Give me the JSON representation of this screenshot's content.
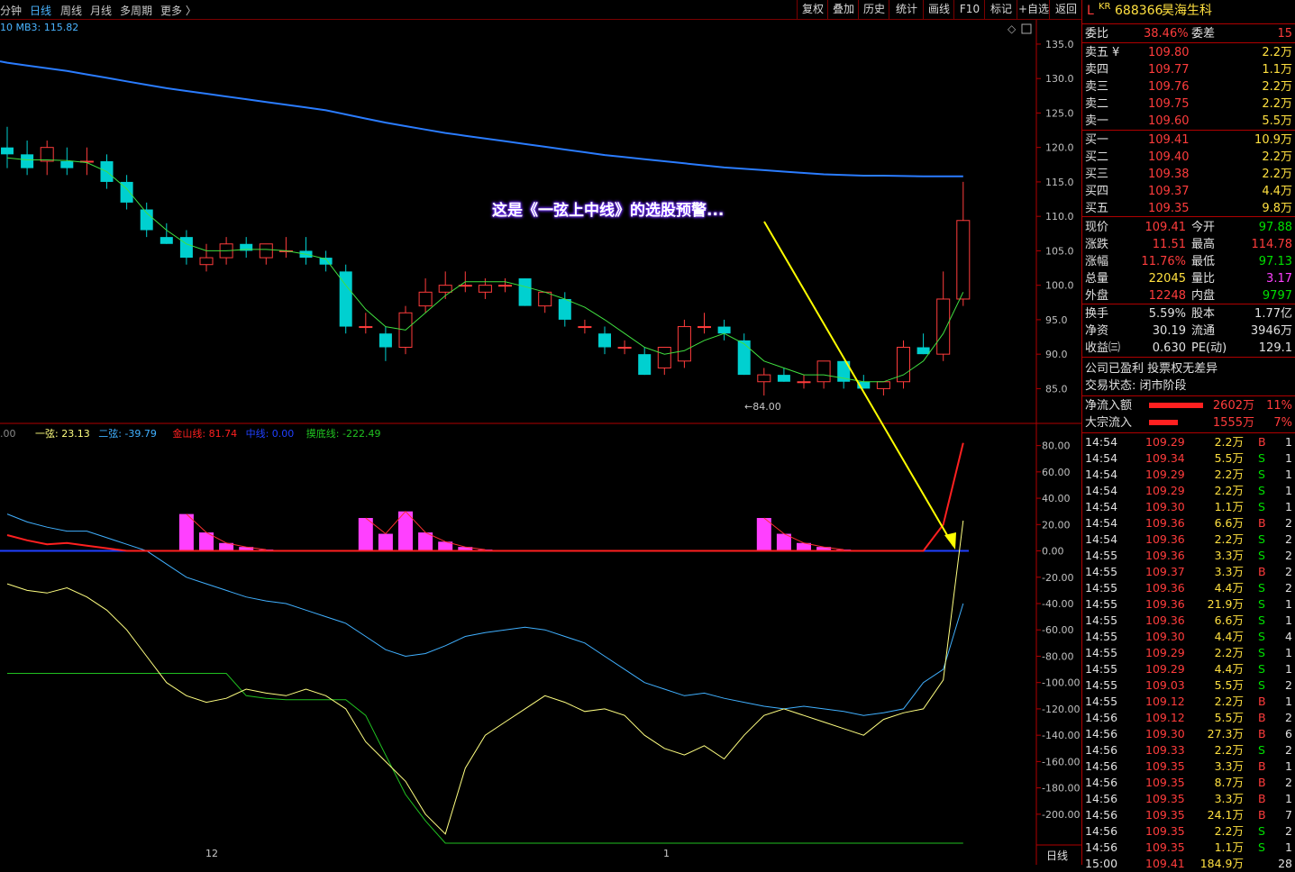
{
  "toolbar": {
    "periods": [
      "分钟",
      "日线",
      "周线",
      "月线",
      "多周期",
      "更多 〉"
    ],
    "active_period": "日线",
    "buttons": [
      "复权",
      "叠加",
      "历史",
      "统计",
      "画线",
      "F10",
      "标记",
      "+自选",
      "返回"
    ]
  },
  "main_chart": {
    "ma_label": "10  MB3: 115.82",
    "low_marker": "←84.00",
    "y_ticks": [
      "135.0",
      "130.0",
      "125.0",
      "120.0",
      "115.0",
      "110.0",
      "105.0",
      "100.0",
      "95.0",
      "90.0",
      "85.0"
    ],
    "annotation": "这是《一弦上中线》的选股预警..."
  },
  "indicator": {
    "prefix": ".00",
    "legend": [
      {
        "label": "一弦: 23.13",
        "color": "#ffff80"
      },
      {
        "label": "二弦: -39.79",
        "color": "#40b0ff"
      },
      {
        "label": "金山线: 81.74",
        "color": "#ff2020"
      },
      {
        "label": "中线: 0.00",
        "color": "#2040ff"
      },
      {
        "label": "摸底线: -222.49",
        "color": "#20c020"
      }
    ],
    "y_ticks": [
      "80.00",
      "60.00",
      "40.00",
      "20.00",
      "0.00",
      "-20.00",
      "-40.00",
      "-60.00",
      "-80.00",
      "-100.00",
      "-120.00",
      "-140.00",
      "-160.00",
      "-180.00",
      "-200.00"
    ],
    "x_labels": [
      "12",
      "1"
    ],
    "period_tab": "日线"
  },
  "stock": {
    "flag": "L",
    "market": "KR",
    "code": "688366",
    "name": "昊海生科"
  },
  "order_ratio": {
    "label": "委比",
    "value": "38.46%",
    "label2": "委差",
    "value2": "15"
  },
  "asks": [
    {
      "label": "卖五",
      "mark": "¥",
      "price": "109.80",
      "vol": "2.2万"
    },
    {
      "label": "卖四",
      "mark": "",
      "price": "109.77",
      "vol": "1.1万"
    },
    {
      "label": "卖三",
      "mark": "",
      "price": "109.76",
      "vol": "2.2万"
    },
    {
      "label": "卖二",
      "mark": "",
      "price": "109.75",
      "vol": "2.2万"
    },
    {
      "label": "卖一",
      "mark": "",
      "price": "109.60",
      "vol": "5.5万"
    }
  ],
  "bids": [
    {
      "label": "买一",
      "price": "109.41",
      "vol": "10.9万"
    },
    {
      "label": "买二",
      "price": "109.40",
      "vol": "2.2万"
    },
    {
      "label": "买三",
      "price": "109.38",
      "vol": "2.2万"
    },
    {
      "label": "买四",
      "price": "109.37",
      "vol": "4.4万"
    },
    {
      "label": "买五",
      "price": "109.35",
      "vol": "9.8万"
    }
  ],
  "quote": [
    {
      "l1": "现价",
      "v1": "109.41",
      "c1": "red",
      "l2": "今开",
      "v2": "97.88",
      "c2": "green"
    },
    {
      "l1": "涨跌",
      "v1": "11.51",
      "c1": "red",
      "l2": "最高",
      "v2": "114.78",
      "c2": "red"
    },
    {
      "l1": "涨幅",
      "v1": "11.76%",
      "c1": "red",
      "l2": "最低",
      "v2": "97.13",
      "c2": "green"
    },
    {
      "l1": "总量",
      "v1": "22045",
      "c1": "yellow",
      "l2": "量比",
      "v2": "3.17",
      "c2": "magenta"
    },
    {
      "l1": "外盘",
      "v1": "12248",
      "c1": "red",
      "l2": "内盘",
      "v2": "9797",
      "c2": "green"
    }
  ],
  "fundamentals": [
    {
      "l1": "换手",
      "v1": "5.59%",
      "l2": "股本",
      "v2": "1.77亿"
    },
    {
      "l1": "净资",
      "v1": "30.19",
      "l2": "流通",
      "v2": "3946万"
    },
    {
      "l1": "收益㈢",
      "v1": "0.630",
      "l2": "PE(动)",
      "v2": "129.1"
    }
  ],
  "status_lines": [
    "公司已盈利 投票权无差异",
    "交易状态: 闭市阶段"
  ],
  "flows": [
    {
      "label": "净流入额",
      "value": "2602万",
      "pct": "11%",
      "bar": 0.85
    },
    {
      "label": "大宗流入",
      "value": "1555万",
      "pct": "7%",
      "bar": 0.45
    }
  ],
  "ticks": [
    {
      "t": "14:54",
      "p": "109.29",
      "v": "2.2万",
      "bs": "B",
      "n": "1"
    },
    {
      "t": "14:54",
      "p": "109.34",
      "v": "5.5万",
      "bs": "S",
      "n": "1"
    },
    {
      "t": "14:54",
      "p": "109.29",
      "v": "2.2万",
      "bs": "S",
      "n": "1"
    },
    {
      "t": "14:54",
      "p": "109.29",
      "v": "2.2万",
      "bs": "S",
      "n": "1"
    },
    {
      "t": "14:54",
      "p": "109.30",
      "v": "1.1万",
      "bs": "S",
      "n": "1"
    },
    {
      "t": "14:54",
      "p": "109.36",
      "v": "6.6万",
      "bs": "B",
      "n": "2"
    },
    {
      "t": "14:54",
      "p": "109.36",
      "v": "2.2万",
      "bs": "S",
      "n": "2"
    },
    {
      "t": "14:55",
      "p": "109.36",
      "v": "3.3万",
      "bs": "S",
      "n": "2"
    },
    {
      "t": "14:55",
      "p": "109.37",
      "v": "3.3万",
      "bs": "B",
      "n": "2"
    },
    {
      "t": "14:55",
      "p": "109.36",
      "v": "4.4万",
      "bs": "S",
      "n": "2"
    },
    {
      "t": "14:55",
      "p": "109.36",
      "v": "21.9万",
      "bs": "S",
      "n": "1"
    },
    {
      "t": "14:55",
      "p": "109.36",
      "v": "6.6万",
      "bs": "S",
      "n": "1"
    },
    {
      "t": "14:55",
      "p": "109.30",
      "v": "4.4万",
      "bs": "S",
      "n": "4"
    },
    {
      "t": "14:55",
      "p": "109.29",
      "v": "2.2万",
      "bs": "S",
      "n": "1"
    },
    {
      "t": "14:55",
      "p": "109.29",
      "v": "4.4万",
      "bs": "S",
      "n": "1"
    },
    {
      "t": "14:55",
      "p": "109.03",
      "v": "5.5万",
      "bs": "S",
      "n": "2"
    },
    {
      "t": "14:55",
      "p": "109.12",
      "v": "2.2万",
      "bs": "B",
      "n": "1"
    },
    {
      "t": "14:56",
      "p": "109.12",
      "v": "5.5万",
      "bs": "B",
      "n": "2"
    },
    {
      "t": "14:56",
      "p": "109.30",
      "v": "27.3万",
      "bs": "B",
      "n": "6"
    },
    {
      "t": "14:56",
      "p": "109.33",
      "v": "2.2万",
      "bs": "S",
      "n": "2"
    },
    {
      "t": "14:56",
      "p": "109.35",
      "v": "3.3万",
      "bs": "B",
      "n": "1"
    },
    {
      "t": "14:56",
      "p": "109.35",
      "v": "8.7万",
      "bs": "B",
      "n": "2"
    },
    {
      "t": "14:56",
      "p": "109.35",
      "v": "3.3万",
      "bs": "B",
      "n": "1"
    },
    {
      "t": "14:56",
      "p": "109.35",
      "v": "24.1万",
      "bs": "B",
      "n": "7"
    },
    {
      "t": "14:56",
      "p": "109.35",
      "v": "2.2万",
      "bs": "S",
      "n": "2"
    },
    {
      "t": "14:56",
      "p": "109.35",
      "v": "1.1万",
      "bs": "S",
      "n": "1"
    },
    {
      "t": "15:00",
      "p": "109.41",
      "v": "184.9万",
      "bs": "",
      "n": "28"
    }
  ],
  "chart_data": {
    "type": "candlestick",
    "price_ylim": [
      81,
      138
    ],
    "indicator_ylim": [
      -222,
      90
    ],
    "candles": [
      {
        "o": 120,
        "h": 123,
        "l": 117,
        "c": 119
      },
      {
        "o": 119,
        "h": 121,
        "l": 116,
        "c": 117
      },
      {
        "o": 118,
        "h": 121,
        "l": 116,
        "c": 120
      },
      {
        "o": 118,
        "h": 120,
        "l": 116,
        "c": 117
      },
      {
        "o": 118,
        "h": 120,
        "l": 116,
        "c": 118
      },
      {
        "o": 118,
        "h": 119,
        "l": 114,
        "c": 115
      },
      {
        "o": 115,
        "h": 116,
        "l": 111,
        "c": 112
      },
      {
        "o": 111,
        "h": 112,
        "l": 107,
        "c": 108
      },
      {
        "o": 107,
        "h": 109,
        "l": 106,
        "c": 106
      },
      {
        "o": 107,
        "h": 108,
        "l": 103,
        "c": 104
      },
      {
        "o": 103,
        "h": 106,
        "l": 102,
        "c": 104
      },
      {
        "o": 104,
        "h": 107,
        "l": 103,
        "c": 106
      },
      {
        "o": 106,
        "h": 107,
        "l": 104,
        "c": 105
      },
      {
        "o": 104,
        "h": 106,
        "l": 103,
        "c": 106
      },
      {
        "o": 105,
        "h": 107,
        "l": 104,
        "c": 105
      },
      {
        "o": 105,
        "h": 107,
        "l": 103,
        "c": 104
      },
      {
        "o": 104,
        "h": 105,
        "l": 102,
        "c": 103
      },
      {
        "o": 102,
        "h": 103,
        "l": 93,
        "c": 94
      },
      {
        "o": 94,
        "h": 96,
        "l": 93,
        "c": 94
      },
      {
        "o": 93,
        "h": 94,
        "l": 89,
        "c": 91
      },
      {
        "o": 91,
        "h": 97,
        "l": 90,
        "c": 96
      },
      {
        "o": 97,
        "h": 101,
        "l": 96,
        "c": 99
      },
      {
        "o": 99,
        "h": 102,
        "l": 98,
        "c": 100
      },
      {
        "o": 100,
        "h": 102,
        "l": 99,
        "c": 100
      },
      {
        "o": 99,
        "h": 101,
        "l": 98,
        "c": 100
      },
      {
        "o": 100,
        "h": 101,
        "l": 99,
        "c": 100
      },
      {
        "o": 101,
        "h": 101,
        "l": 97,
        "c": 97
      },
      {
        "o": 97,
        "h": 99,
        "l": 96,
        "c": 99
      },
      {
        "o": 98,
        "h": 99,
        "l": 94,
        "c": 95
      },
      {
        "o": 94,
        "h": 95,
        "l": 93,
        "c": 94
      },
      {
        "o": 93,
        "h": 94,
        "l": 90,
        "c": 91
      },
      {
        "o": 91,
        "h": 92,
        "l": 90,
        "c": 91
      },
      {
        "o": 90,
        "h": 91,
        "l": 87,
        "c": 87
      },
      {
        "o": 88,
        "h": 91,
        "l": 87,
        "c": 91
      },
      {
        "o": 89,
        "h": 95,
        "l": 88,
        "c": 94
      },
      {
        "o": 94,
        "h": 96,
        "l": 93,
        "c": 94
      },
      {
        "o": 94,
        "h": 95,
        "l": 92,
        "c": 93
      },
      {
        "o": 92,
        "h": 93,
        "l": 87,
        "c": 87
      },
      {
        "o": 86,
        "h": 88,
        "l": 84,
        "c": 87
      },
      {
        "o": 87,
        "h": 88,
        "l": 86,
        "c": 86
      },
      {
        "o": 86,
        "h": 87,
        "l": 85,
        "c": 86
      },
      {
        "o": 86,
        "h": 89,
        "l": 85,
        "c": 89
      },
      {
        "o": 89,
        "h": 89,
        "l": 85,
        "c": 86
      },
      {
        "o": 86,
        "h": 87,
        "l": 85,
        "c": 85
      },
      {
        "o": 85,
        "h": 86,
        "l": 84,
        "c": 86
      },
      {
        "o": 86,
        "h": 92,
        "l": 85,
        "c": 91
      },
      {
        "o": 91,
        "h": 93,
        "l": 90,
        "c": 90
      },
      {
        "o": 90,
        "h": 102,
        "l": 89,
        "c": 98
      },
      {
        "o": 98,
        "h": 115,
        "l": 97,
        "c": 109.4
      }
    ],
    "ma_fast": [
      118.5,
      118.2,
      118.2,
      118.1,
      117.8,
      116.5,
      114,
      110.5,
      108,
      106,
      105,
      105,
      105.2,
      105.2,
      105,
      104.5,
      103.8,
      100,
      96.5,
      94,
      93.5,
      96,
      98.5,
      100.5,
      100.5,
      100.5,
      99.8,
      99,
      98,
      96.8,
      95,
      93,
      91,
      90,
      90.5,
      92,
      93,
      91.5,
      89,
      88,
      87,
      87,
      86.5,
      86,
      86,
      87,
      89,
      93,
      99
    ],
    "ma_long": [
      132.3,
      131.9,
      131.5,
      131.1,
      130.6,
      130.1,
      129.6,
      129.1,
      128.6,
      128.2,
      127.8,
      127.4,
      127,
      126.6,
      126.2,
      125.8,
      125.4,
      124.8,
      124.2,
      123.6,
      123.1,
      122.6,
      122.1,
      121.7,
      121.3,
      120.9,
      120.5,
      120.1,
      119.7,
      119.3,
      118.9,
      118.6,
      118.3,
      118.0,
      117.7,
      117.4,
      117.1,
      116.9,
      116.7,
      116.5,
      116.3,
      116.1,
      116,
      115.9,
      115.9,
      115.85,
      115.82,
      115.82,
      115.82
    ],
    "line1": [
      -25,
      -30,
      -32,
      -28,
      -35,
      -45,
      -60,
      -80,
      -100,
      -110,
      -115,
      -112,
      -105,
      -108,
      -110,
      -105,
      -110,
      -120,
      -145,
      -160,
      -175,
      -200,
      -215,
      -165,
      -140,
      -130,
      -120,
      -110,
      -115,
      -122,
      -120,
      -125,
      -140,
      -150,
      -155,
      -148,
      -158,
      -140,
      -125,
      -120,
      -125,
      -130,
      -135,
      -140,
      -128,
      -123,
      -120,
      -98,
      23
    ],
    "line2": [
      28,
      22,
      18,
      15,
      15,
      10,
      5,
      0,
      -10,
      -20,
      -25,
      -30,
      -35,
      -38,
      -40,
      -45,
      -50,
      -55,
      -65,
      -75,
      -80,
      -78,
      -72,
      -65,
      -62,
      -60,
      -58,
      -60,
      -65,
      -70,
      -80,
      -90,
      -100,
      -105,
      -110,
      -108,
      -112,
      -115,
      -118,
      -120,
      -118,
      -120,
      -122,
      -125,
      -123,
      -120,
      -100,
      -90,
      -40
    ],
    "jin_line": [
      12,
      8,
      5,
      6,
      4,
      2,
      0,
      0,
      0,
      0,
      0,
      0,
      0,
      0,
      0,
      0,
      0,
      0,
      0,
      0,
      0,
      0,
      0,
      0,
      0,
      0,
      0,
      0,
      0,
      0,
      0,
      0,
      0,
      0,
      0,
      0,
      0,
      0,
      0,
      0,
      0,
      0,
      0,
      0,
      0,
      0,
      0,
      20,
      82
    ],
    "bottom_line": [
      -93,
      -93,
      -93,
      -93,
      -93,
      -93,
      -93,
      -93,
      -93,
      -93,
      -93,
      -93,
      -110,
      -112,
      -113,
      -113,
      -113,
      -113,
      -125,
      -155,
      -185,
      -205,
      -222,
      -222,
      -222,
      -222,
      -222,
      -222,
      -222,
      -222,
      -222,
      -222,
      -222,
      -222,
      -222,
      -222,
      -222,
      -222,
      -222,
      -222,
      -222,
      -222,
      -222,
      -222,
      -222,
      -222,
      -222,
      -222,
      -222
    ],
    "bars": [
      0,
      0,
      0,
      0,
      0,
      0,
      0,
      0,
      0,
      28,
      14,
      6,
      3,
      1,
      0,
      0,
      0,
      0,
      25,
      13,
      30,
      14,
      7,
      3,
      1,
      0,
      0,
      0,
      0,
      0,
      0,
      0,
      0,
      0,
      0,
      0,
      0,
      0,
      25,
      13,
      6,
      3,
      1,
      0,
      0,
      0,
      0,
      0,
      0
    ]
  }
}
